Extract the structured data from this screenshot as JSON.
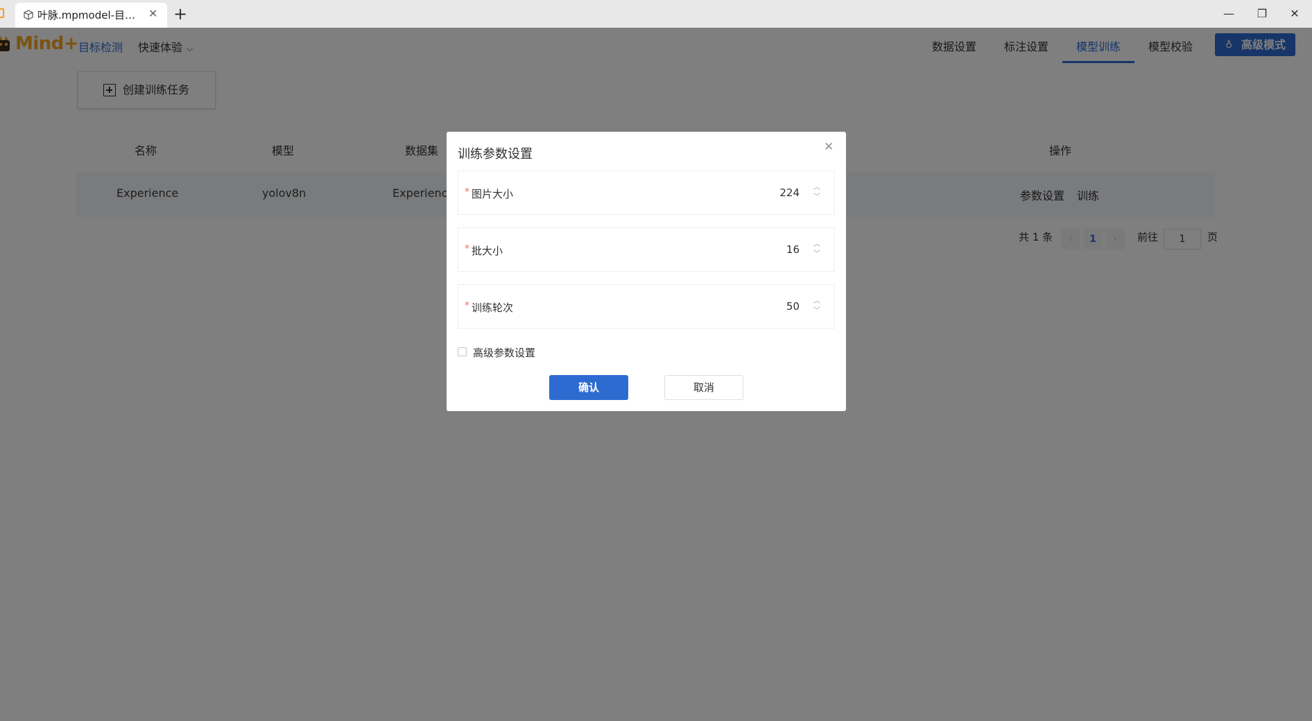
{
  "browser": {
    "tab_title": "叶脉.mpmodel-目…",
    "close_glyph": "✕",
    "new_tab_glyph": "+",
    "window_controls": {
      "minimize": "—",
      "restore": "❐",
      "close": "✕"
    }
  },
  "header": {
    "logo_text": "Mind+",
    "current_module": "目标检测",
    "quick_menu": "快速体验",
    "chevron": "⌵",
    "tabs": [
      {
        "label": "数据设置"
      },
      {
        "label": "标注设置"
      },
      {
        "label": "模型训练"
      },
      {
        "label": "模型校验"
      }
    ],
    "active_tab": "模型训练",
    "advanced_mode": "高级模式",
    "flask_glyph": "♁"
  },
  "toolbar": {
    "create_task": "创建训练任务"
  },
  "table": {
    "columns": [
      "名称",
      "模型",
      "数据集",
      "操作"
    ],
    "rows": [
      {
        "name": "Experience",
        "model": "yolov8n",
        "dataset": "Experience",
        "actions": [
          "参数设置",
          "训练"
        ]
      }
    ]
  },
  "pagination": {
    "total_text": "共 1 条",
    "prev": "‹",
    "next": "›",
    "current_page": "1",
    "goto_label": "前往",
    "goto_value": "1",
    "page_suffix": "页"
  },
  "dialog": {
    "title": "训练参数设置",
    "close_glyph": "✕",
    "required_mark": "*",
    "spin_up": "︿",
    "spin_down": "﹀",
    "fields": [
      {
        "label": "图片大小",
        "value": "224"
      },
      {
        "label": "批大小",
        "value": "16"
      },
      {
        "label": "训练轮次",
        "value": "50"
      }
    ],
    "advanced_checkbox": "高级参数设置",
    "advanced_checked": false,
    "confirm": "确认",
    "cancel": "取消"
  },
  "colors": {
    "primary": "#2e6bd0",
    "brand": "#f5a623",
    "required": "#f56c6c",
    "overlay": "rgba(0,0,0,0.5)"
  }
}
